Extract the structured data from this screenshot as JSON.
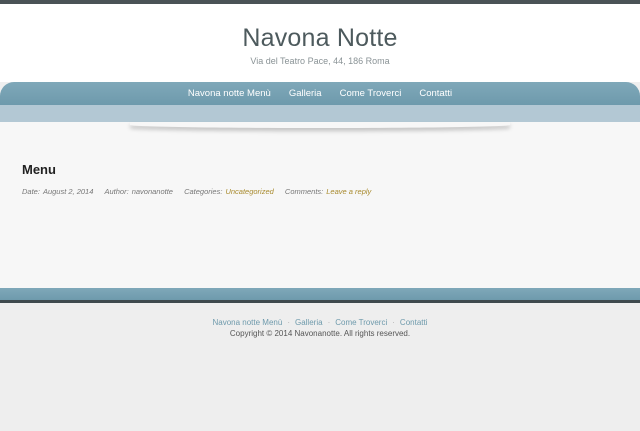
{
  "header": {
    "title": "Navona Notte",
    "description": "Via del Teatro Pace, 44, 186 Roma"
  },
  "nav": {
    "items": [
      {
        "label": "Navona notte Menù"
      },
      {
        "label": "Galleria"
      },
      {
        "label": "Come Troverci"
      },
      {
        "label": "Contatti"
      }
    ]
  },
  "post": {
    "title": "Menu",
    "date_label": "Date:",
    "date": "August 2, 2014",
    "author_label": "Author:",
    "author": "navonanotte",
    "categories_label": "Categories:",
    "category": "Uncategorized",
    "comments_label": "Comments:",
    "comments_link": "Leave a reply"
  },
  "footer": {
    "links": [
      {
        "label": "Navona notte Menù"
      },
      {
        "label": "Galleria"
      },
      {
        "label": "Come Troverci"
      },
      {
        "label": "Contatti"
      }
    ],
    "separator": "·",
    "copyright": "Copyright © 2014 Navonanotte. All rights reserved."
  },
  "colors": {
    "nav_blue": "#74a0b2",
    "subnav_blue": "#b3c8d4",
    "link_gold": "#a88a2d",
    "title_gray": "#4d5a5d"
  }
}
